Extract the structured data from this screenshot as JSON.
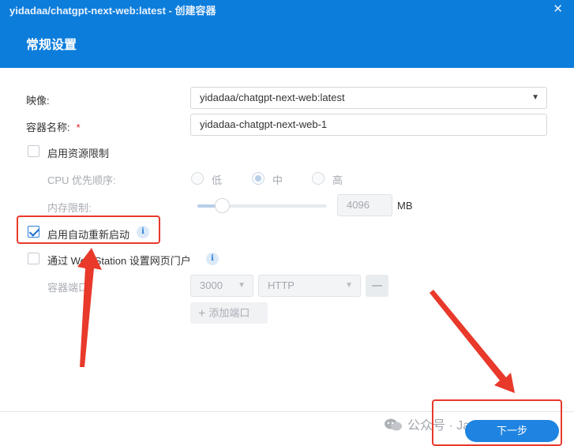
{
  "window": {
    "title": "yidadaa/chatgpt-next-web:latest - 创建容器",
    "close_glyph": "✕"
  },
  "section": {
    "title": "常规设置"
  },
  "form": {
    "image_label": "映像:",
    "image_value": "yidadaa/chatgpt-next-web:latest",
    "name_label": "容器名称:",
    "name_required": "*",
    "name_value": "yidadaa-chatgpt-next-web-1",
    "resource_limit_label": "启用资源限制",
    "resource_limit_checked": false,
    "cpu_priority_label": "CPU 优先顺序:",
    "cpu_options": [
      "低",
      "中",
      "高"
    ],
    "cpu_selected": "中",
    "memory_label": "内存限制:",
    "memory_value": "4096",
    "memory_unit": "MB",
    "auto_restart_label": "启用自动重新启动",
    "auto_restart_checked": true,
    "web_station_label": "通过 Web Station 设置网页门户",
    "web_station_checked": false,
    "port_label": "容器端口:",
    "port_value": "3000",
    "protocol_value": "HTTP",
    "add_port_label": "添加端口",
    "info_glyph": "i",
    "caret_glyph": "▼"
  },
  "footer": {
    "next_label": "下一步",
    "watermark": "公众号 · Jack Bytes"
  },
  "colors": {
    "header_blue": "#0d7ddc",
    "primary_button": "#1f84e1",
    "annotation_red": "#e8392b"
  },
  "icons": [
    "close-icon",
    "dropdown-caret-icon",
    "info-icon",
    "checkmark-icon",
    "plus-icon",
    "minus-icon",
    "wechat-icon",
    "annotation-arrow-icon"
  ]
}
